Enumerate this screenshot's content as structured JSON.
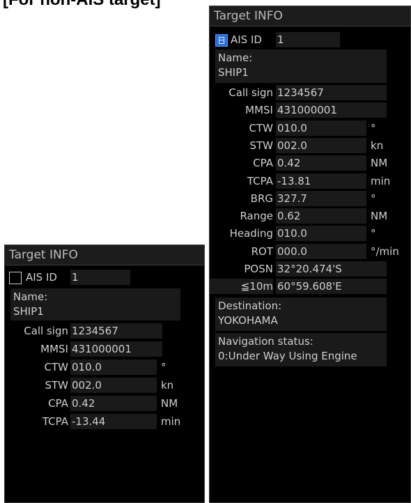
{
  "heading": "[For non-AIS target]",
  "panel_small": {
    "title": "Target INFO",
    "ais_label": "AIS ID",
    "ais_value": "1",
    "name_label": "Name:",
    "name_value": "SHIP1",
    "rows": [
      {
        "label": "Call sign",
        "value": "1234567",
        "unit": ""
      },
      {
        "label": "MMSI",
        "value": "431000001",
        "unit": ""
      },
      {
        "label": "CTW",
        "value": "010.0",
        "unit": "°"
      },
      {
        "label": "STW",
        "value": "002.0",
        "unit": "kn"
      },
      {
        "label": "CPA",
        "value": "0.42",
        "unit": "NM"
      },
      {
        "label": "TCPA",
        "value": "-13.44",
        "unit": "min"
      }
    ]
  },
  "panel_large": {
    "title": "Target INFO",
    "ais_label": "AIS ID",
    "ais_value": "1",
    "name_label": "Name:",
    "name_value": "SHIP1",
    "rows": [
      {
        "label": "Call sign",
        "value": "1234567",
        "unit": ""
      },
      {
        "label": "MMSI",
        "value": "431000001",
        "unit": ""
      },
      {
        "label": "CTW",
        "value": "010.0",
        "unit": "°"
      },
      {
        "label": "STW",
        "value": "002.0",
        "unit": "kn"
      },
      {
        "label": "CPA",
        "value": "0.42",
        "unit": "NM"
      },
      {
        "label": "TCPA",
        "value": "-13.81",
        "unit": "min"
      },
      {
        "label": "BRG",
        "value": "327.7",
        "unit": "°"
      },
      {
        "label": "Range",
        "value": "0.62",
        "unit": "NM"
      },
      {
        "label": "Heading",
        "value": "010.0",
        "unit": "°"
      },
      {
        "label": "ROT",
        "value": "000.0",
        "unit": "°/min"
      }
    ],
    "posn_label": "POSN",
    "lat": "32°20.474'S",
    "acc_label": "≦10m",
    "lon": "60°59.608'E",
    "dest_label": "Destination:",
    "dest_value": "YOKOHAMA",
    "nav_label": "Navigation status:",
    "nav_value": "0:Under Way Using Engine"
  }
}
